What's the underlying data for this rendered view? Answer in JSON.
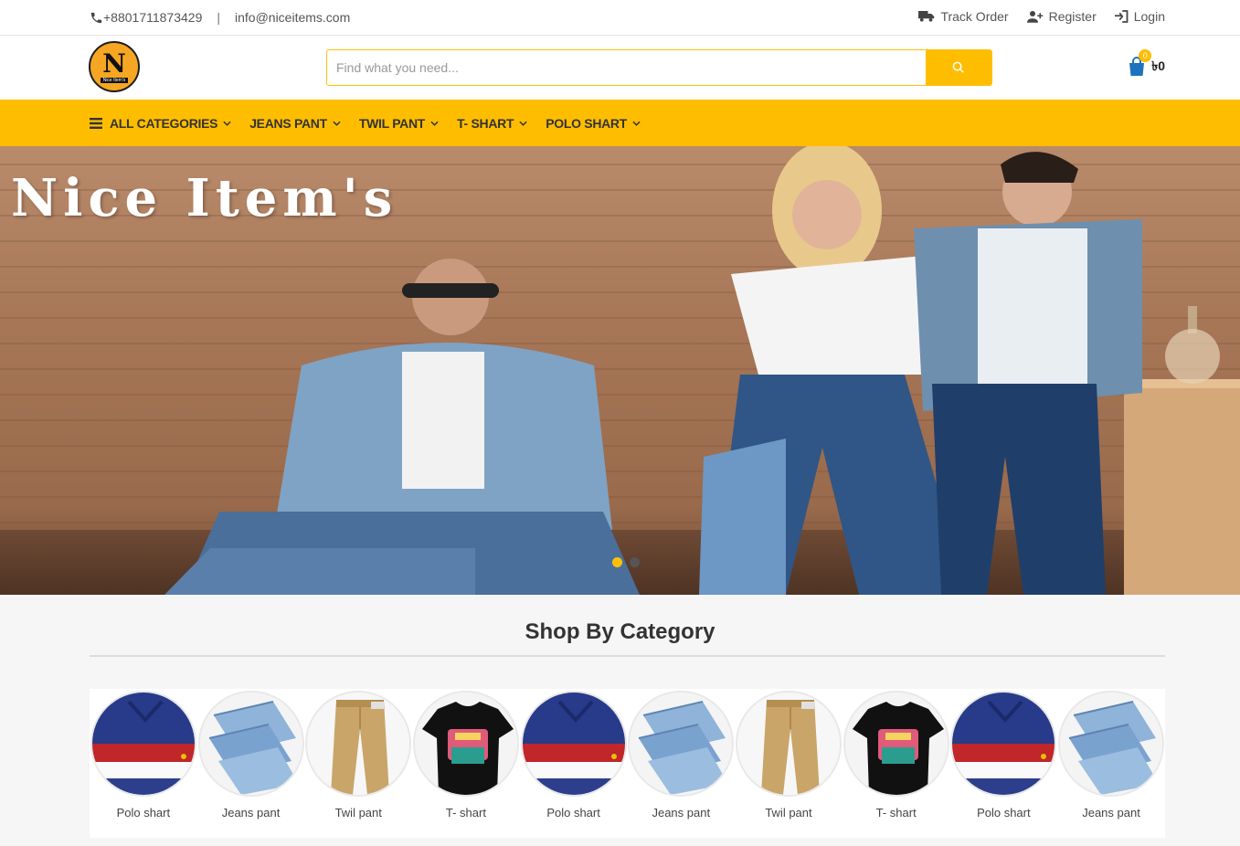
{
  "topbar": {
    "phone": "+8801711873429",
    "separator": "|",
    "email": "info@niceitems.com",
    "track_order": "Track Order",
    "register": "Register",
    "login": "Login"
  },
  "header": {
    "logo_monogram": "N",
    "logo_tagline": "Nice Item's",
    "search_placeholder": "Find what you need...",
    "cart_count": "0",
    "cart_amount": "৳0"
  },
  "nav": {
    "items": [
      {
        "label": "ALL CATEGORIES"
      },
      {
        "label": "JEANS PANT"
      },
      {
        "label": "TWIL PANT"
      },
      {
        "label": "T- SHART"
      },
      {
        "label": "POLO SHART"
      }
    ]
  },
  "hero": {
    "title": "Nice Item's",
    "slides_total": 2,
    "active_slide": 1
  },
  "section": {
    "title": "Shop By Category",
    "categories": [
      {
        "label": "Polo shart",
        "kind": "polo"
      },
      {
        "label": "Jeans pant",
        "kind": "jeans"
      },
      {
        "label": "Twil pant",
        "kind": "twill"
      },
      {
        "label": "T- shart",
        "kind": "tshirt"
      },
      {
        "label": "Polo shart",
        "kind": "polo"
      },
      {
        "label": "Jeans pant",
        "kind": "jeans"
      },
      {
        "label": "Twil pant",
        "kind": "twill"
      },
      {
        "label": "T- shart",
        "kind": "tshirt"
      },
      {
        "label": "Polo shart",
        "kind": "polo"
      },
      {
        "label": "Jeans pant",
        "kind": "jeans"
      }
    ]
  },
  "colors": {
    "accent": "#ffbd00",
    "text": "#333333"
  },
  "icons": [
    "phone-icon",
    "truck-icon",
    "user-plus-icon",
    "sign-in-icon",
    "search-icon",
    "shopping-bag-icon",
    "bars-icon",
    "chevron-down-icon"
  ]
}
